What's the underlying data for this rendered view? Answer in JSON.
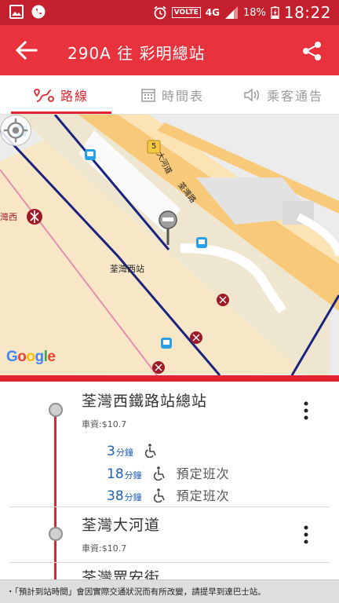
{
  "status_bar": {
    "network": "4G",
    "volte": "VOLTE",
    "battery": "18%",
    "time": "18:22"
  },
  "app_bar": {
    "title": "290A 往 彩明總站",
    "back_icon": "arrow-left-icon",
    "share_icon": "share-icon"
  },
  "tabs": [
    {
      "label": "路線",
      "icon": "route-icon",
      "active": true
    },
    {
      "label": "時間表",
      "icon": "calendar-icon",
      "active": false
    },
    {
      "label": "乘客通告",
      "icon": "speaker-icon",
      "active": false
    }
  ],
  "map": {
    "station_label": "荃灣西站",
    "road_label_1": "大河道",
    "road_label_2": "荃灣路",
    "road_shield": "5",
    "mtr_label": "灣西",
    "google_letters": [
      "G",
      "o",
      "o",
      "g",
      "l",
      "e"
    ],
    "google_colors": [
      "#4285F4",
      "#EA4335",
      "#FBBC05",
      "#4285F4",
      "#34A853",
      "#EA4335"
    ]
  },
  "stops": [
    {
      "name": "荃灣西鐵路站總站",
      "fare": "車資:$10.7",
      "etas": [
        {
          "value": "3",
          "unit": "分鐘",
          "note": ""
        },
        {
          "value": "18",
          "unit": "分鐘",
          "note": "預定班次"
        },
        {
          "value": "38",
          "unit": "分鐘",
          "note": "預定班次"
        }
      ]
    },
    {
      "name": "荃灣大河道",
      "fare": "車資:$10.7",
      "etas": []
    },
    {
      "name": "荃灣眾安街",
      "fare": "",
      "etas": []
    }
  ],
  "notice": "・「預計到站時間」會因實際交通狀況而有所改變，請提早到達巴士站。",
  "colors": {
    "status_bar": "#c41f2d",
    "app_bar": "#e8323e",
    "accent": "#e0232e",
    "eta": "#1e5fb5",
    "bus_route": "#1a237e"
  }
}
